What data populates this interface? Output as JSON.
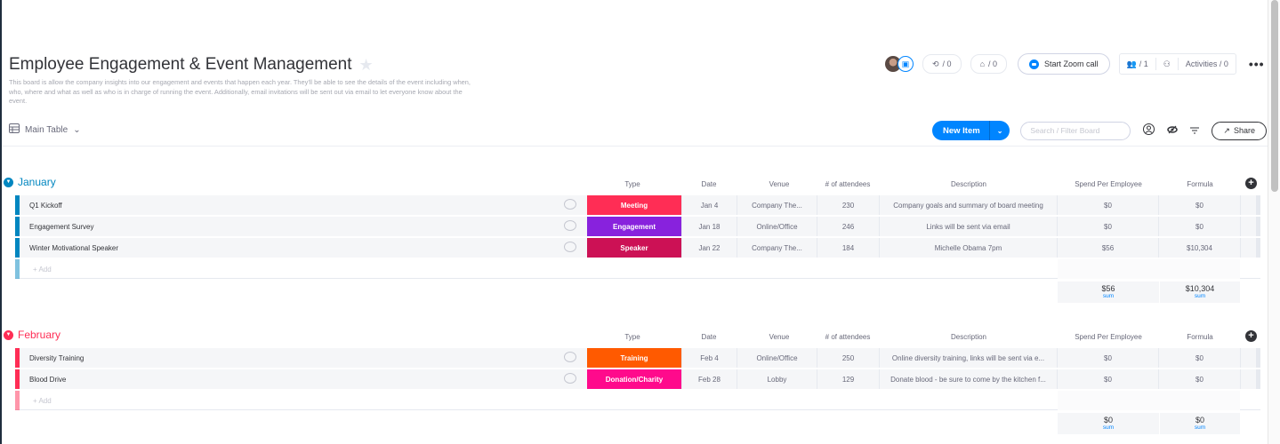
{
  "board": {
    "title": "Employee Engagement & Event Management",
    "star_icon": "★",
    "description": "This board is allow the company insights into our engagement and events that happen each year. They'll be able to see the details of the event including when, who, where and what as well as who is in charge of running the event. Additionally, email invitations will be sent out via email to let everyone know about the event."
  },
  "topbar": {
    "integrations": "/ 0",
    "automations": "/ 0",
    "zoom_label": "Start Zoom call",
    "members": "/ 1",
    "activities": "Activities / 0",
    "more": "•••"
  },
  "view": {
    "label": "Main Table",
    "caret": "⌄"
  },
  "toolbar": {
    "new_item": "New Item",
    "caret": "⌄",
    "search_placeholder": "Search / Filter Board",
    "share": "Share"
  },
  "columns": [
    "Type",
    "Date",
    "Venue",
    "# of attendees",
    "Description",
    "Spend Per Employee",
    "Formula"
  ],
  "groups": [
    {
      "name": "January",
      "color": "#0086c0",
      "add_label": "+ Add",
      "rows": [
        {
          "name": "Q1 Kickoff",
          "type": "Meeting",
          "type_color": "#ff2d55",
          "date": "Jan 4",
          "venue": "Company The...",
          "attendees": "230",
          "description": "Company goals and summary of board meeting",
          "spend": "$0",
          "formula": "$0"
        },
        {
          "name": "Engagement Survey",
          "type": "Engagement",
          "type_color": "#8822dd",
          "date": "Jan 18",
          "venue": "Online/Office",
          "attendees": "246",
          "description": "Links will be sent via email",
          "spend": "$0",
          "formula": "$0"
        },
        {
          "name": "Winter Motivational Speaker",
          "type": "Speaker",
          "type_color": "#cc1155",
          "date": "Jan 22",
          "venue": "Company The...",
          "attendees": "184",
          "description": "Michelle Obama 7pm",
          "spend": "$56",
          "formula": "$10,304"
        }
      ],
      "sum_spend": "$56",
      "sum_formula": "$10,304",
      "sum_label": "sum"
    },
    {
      "name": "February",
      "color": "#ff2d55",
      "add_label": "+ Add",
      "rows": [
        {
          "name": "Diversity Training",
          "type": "Training",
          "type_color": "#ff5a00",
          "date": "Feb 4",
          "venue": "Online/Office",
          "attendees": "250",
          "description": "Online diversity training, links will be sent via e...",
          "spend": "$0",
          "formula": "$0"
        },
        {
          "name": "Blood Drive",
          "type": "Donation/Charity",
          "type_color": "#ff0a8c",
          "date": "Feb 28",
          "venue": "Lobby",
          "attendees": "129",
          "description": "Donate blood - be sure to come by the kitchen f...",
          "spend": "$0",
          "formula": "$0"
        }
      ],
      "sum_spend": "$0",
      "sum_formula": "$0",
      "sum_label": "sum"
    }
  ]
}
